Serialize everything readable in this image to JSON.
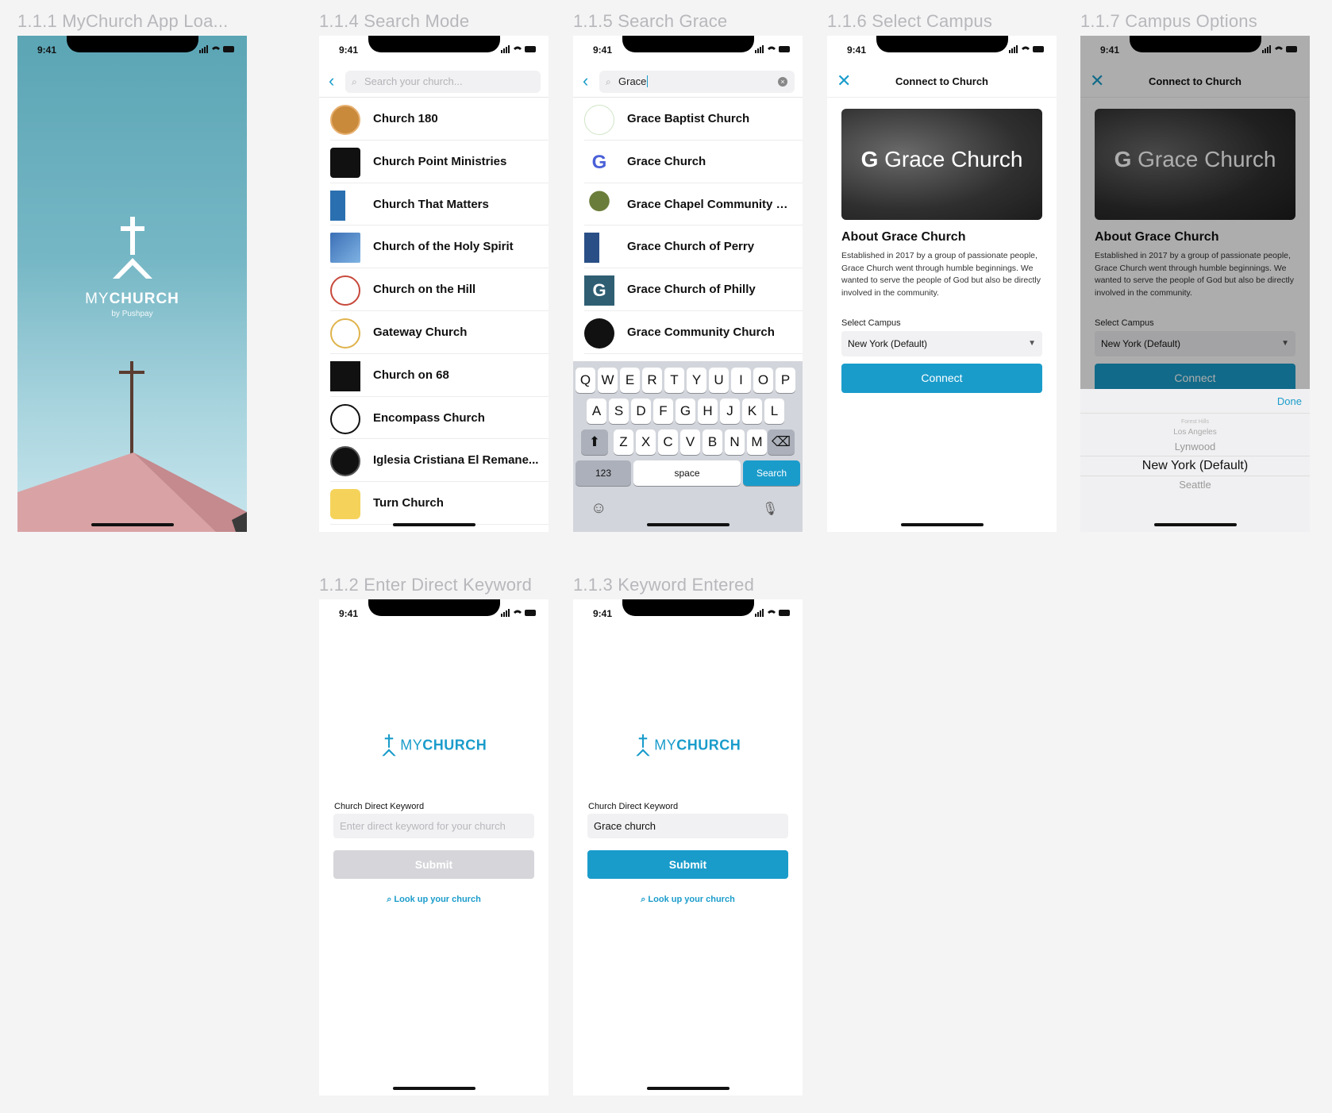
{
  "frames": {
    "f111": "1.1.1 MyChurch App Loa...",
    "f114": "1.1.4 Search Mode",
    "f115": "1.1.5 Search Grace",
    "f116": "1.1.6 Select Campus",
    "f117": "1.1.7 Campus Options",
    "f112": "1.1.2 Enter Direct Keyword",
    "f113": "1.1.3 Keyword Entered"
  },
  "status": {
    "time": "9:41"
  },
  "splash": {
    "brand_my": "MY",
    "brand_church": "CHURCH",
    "sub": "by Pushpay"
  },
  "search_mode": {
    "placeholder": "Search your church...",
    "churches": [
      "Church 180",
      "Church Point Ministries",
      "Church That Matters",
      "Church of the Holy Spirit",
      "Church on the Hill",
      "Gateway Church",
      "Church on 68",
      "Encompass Church",
      "Iglesia Cristiana El Remane...",
      "Turn Church"
    ]
  },
  "search_grace": {
    "query": "Grace",
    "results": [
      "Grace Baptist Church",
      "Grace Church",
      "Grace Chapel Community C...",
      "Grace Church of Perry",
      "Grace Church of Philly",
      "Grace Community Church"
    ],
    "keys_row1": [
      "Q",
      "W",
      "E",
      "R",
      "T",
      "Y",
      "U",
      "I",
      "O",
      "P"
    ],
    "keys_row2": [
      "A",
      "S",
      "D",
      "F",
      "G",
      "H",
      "J",
      "K",
      "L"
    ],
    "keys_row3": [
      "Z",
      "X",
      "C",
      "V",
      "B",
      "N",
      "M"
    ],
    "key_123": "123",
    "key_space": "space",
    "key_search": "Search"
  },
  "connect": {
    "title": "Connect to Church",
    "hero_text": "Grace Church",
    "about_heading": "About Grace Church",
    "about_text": "Established in 2017 by  a group of passionate people, Grace Church went through humble beginnings.  We wanted to serve the people of God but also be directly involved in the community.",
    "campus_label": "Select Campus",
    "campus_value": "New York (Default)",
    "connect_button": "Connect"
  },
  "picker": {
    "done": "Done",
    "options": [
      "Forest Hills",
      "Los Angeles",
      "Lynwood",
      "New York (Default)",
      "Seattle"
    ]
  },
  "direct": {
    "label": "Church Direct Keyword",
    "placeholder": "Enter direct keyword for your church",
    "entered": "Grace church",
    "submit": "Submit",
    "lookup": "Look up your church"
  },
  "colors": {
    "accent": "#1a9ccb",
    "disabled": "#d5d5da"
  }
}
